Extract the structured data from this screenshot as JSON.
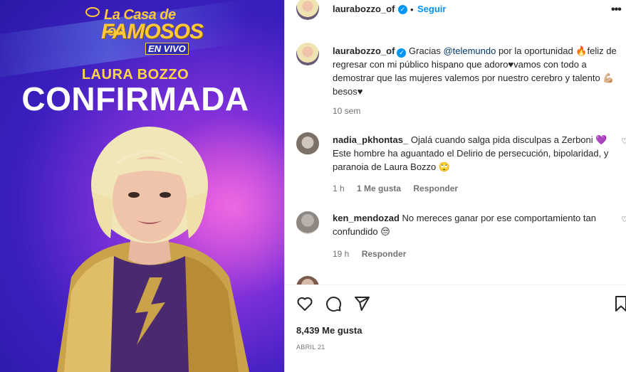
{
  "media": {
    "logo": {
      "line1": "La Casa de los",
      "line2": "FAMOSOS",
      "line3": "EN VIVO"
    },
    "name": "LAURA BOZZO",
    "headline": "CONFIRMADA"
  },
  "header": {
    "username": "laurabozzo_of",
    "follow_label": "Seguir",
    "separator": "•"
  },
  "caption": {
    "username": "laurabozzo_of",
    "text_before": "Gracias ",
    "mention": "@telemundo",
    "text_after": " por la oportunidad 🔥feliz de regresar con mi público hispano que adoro♥vamos con todo a demostrar que las mujeres valemos por nuestro cerebro y talento 💪🏼besos♥",
    "time": "10 sem"
  },
  "comments": [
    {
      "username": "nadia_pkhontas_",
      "text": "Ojalá cuando salga pida disculpas a Zerboni 💜 Este hombre ha aguantado el Delirio de persecución, bipolaridad, y paranoia de Laura Bozzo 🙄",
      "time": "1 h",
      "likes": "1 Me gusta",
      "reply": "Responder"
    },
    {
      "username": "ken_mendozad",
      "text": "No mereces ganar por ese comportamiento tan confundido 😒",
      "time": "19 h",
      "reply": "Responder"
    }
  ],
  "partial_comment": "",
  "footer": {
    "likes": "8,439 Me gusta",
    "date": "ABRIL 21"
  },
  "colors": {
    "accent": "#0095f6",
    "mention": "#00376b",
    "muted": "#737373"
  },
  "icons": [
    "verified-badge-icon",
    "more-options-icon",
    "heart-icon",
    "comment-icon",
    "share-icon",
    "bookmark-icon"
  ]
}
